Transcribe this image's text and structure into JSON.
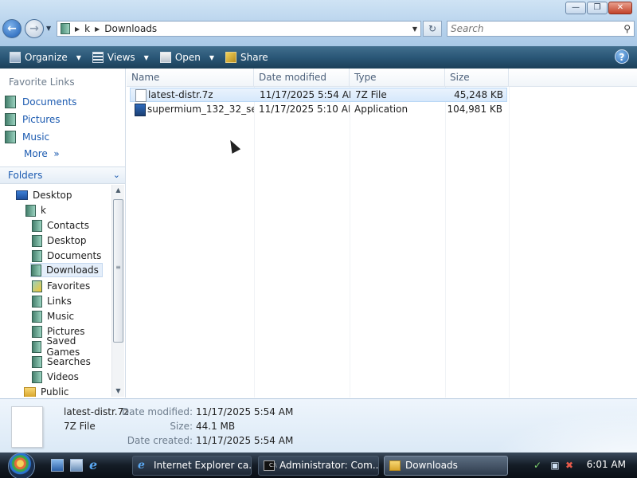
{
  "window": {
    "minimize": "—",
    "maximize": "❐",
    "close": "✕"
  },
  "address": {
    "crumbs": [
      "k",
      "Downloads"
    ],
    "search_placeholder": "Search"
  },
  "toolbar": {
    "organize": "Organize",
    "views": "Views",
    "open": "Open",
    "share": "Share",
    "help": "?"
  },
  "favorites": {
    "title": "Favorite Links",
    "items": [
      "Documents",
      "Pictures",
      "Music"
    ],
    "more": "More"
  },
  "folders": {
    "title": "Folders",
    "tree": [
      "Desktop",
      "k",
      "Contacts",
      "Desktop",
      "Documents",
      "Downloads",
      "Favorites",
      "Links",
      "Music",
      "Pictures",
      "Saved Games",
      "Searches",
      "Videos",
      "Public"
    ],
    "selected": "Downloads"
  },
  "columns": [
    "Name",
    "Date modified",
    "Type",
    "Size"
  ],
  "files": [
    {
      "name": "latest-distr.7z",
      "date": "11/17/2025 5:54 AM",
      "type": "7Z File",
      "size": "45,248 KB",
      "icon": "blank-file-icon"
    },
    {
      "name": "supermium_132_32_set...",
      "date": "11/17/2025 5:10 AM",
      "type": "Application",
      "size": "104,981 KB",
      "icon": "installer-icon"
    }
  ],
  "details": {
    "name": "latest-distr.7z",
    "type": "7Z File",
    "date_modified_label": "Date modified:",
    "date_modified": "11/17/2025 5:54 AM",
    "size_label": "Size:",
    "size": "44.1 MB",
    "date_created_label": "Date created:",
    "date_created": "11/17/2025 5:54 AM"
  },
  "taskbar": {
    "tasks": [
      "Internet Explorer ca...",
      "Administrator: Com...",
      "Downloads"
    ],
    "active_task": "Downloads",
    "clock": "6:01 AM"
  }
}
